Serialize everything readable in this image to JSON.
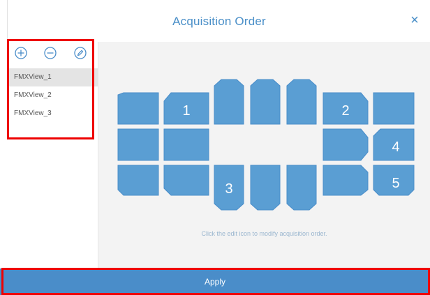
{
  "dialog": {
    "title": "Acquisition Order",
    "close_glyph": "×"
  },
  "toolbar": {
    "add_icon": "plus-circle-icon",
    "remove_icon": "minus-circle-icon",
    "edit_icon": "pencil-circle-icon"
  },
  "views": [
    {
      "label": "FMXView_1",
      "selected": true
    },
    {
      "label": "FMXView_2",
      "selected": false
    },
    {
      "label": "FMXView_3",
      "selected": false
    }
  ],
  "layout_labels": [
    "1",
    "2",
    "3",
    "4",
    "5"
  ],
  "hint": "Click the edit icon to modify acquisition order.",
  "apply_label": "Apply",
  "colors": {
    "accent": "#4a8dc9",
    "tile": "#5a9ed3",
    "highlight": "#ee0000"
  }
}
